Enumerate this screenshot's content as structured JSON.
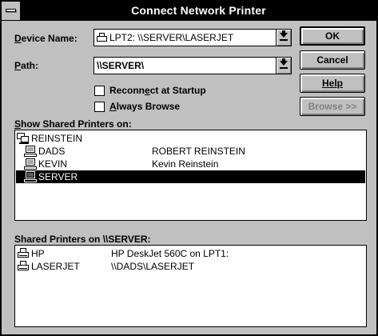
{
  "window": {
    "title": "Connect Network Printer"
  },
  "form": {
    "device_name_label_pre": "",
    "device_name_label_u": "D",
    "device_name_label_post": "evice Name:",
    "device_name_value": "LPT2:  \\\\SERVER\\LASERJET",
    "path_label_u": "P",
    "path_label_post": "ath:",
    "path_value": "\\\\SERVER\\",
    "reconnect_pre": "Reconn",
    "reconnect_u": "e",
    "reconnect_post": "ct at Startup",
    "always_u": "A",
    "always_post": "lways Browse"
  },
  "buttons": {
    "ok": "OK",
    "cancel": "Cancel",
    "help": "Help",
    "browse": "Browse >>"
  },
  "shared_on": {
    "label_u": "S",
    "label_post": "how Shared Printers on:",
    "items": [
      {
        "name": "REINSTEIN",
        "desc": "",
        "icon": "network-icon",
        "selected": false,
        "indent": 0
      },
      {
        "name": "DADS",
        "desc": "ROBERT REINSTEIN",
        "icon": "computer-icon",
        "selected": false,
        "indent": 1
      },
      {
        "name": "KEVIN",
        "desc": "Kevin Reinstein",
        "icon": "computer-icon",
        "selected": false,
        "indent": 1
      },
      {
        "name": "SERVER",
        "desc": "",
        "icon": "computer-icon",
        "selected": true,
        "indent": 1
      }
    ]
  },
  "shared_printers": {
    "label": "Shared Printers on \\\\SERVER:",
    "items": [
      {
        "name": "HP",
        "desc": "HP DeskJet 560C on LPT1:",
        "icon": "printer-icon"
      },
      {
        "name": "LASERJET",
        "desc": "\\\\DADS\\LASERJET",
        "icon": "printer-icon"
      }
    ]
  }
}
